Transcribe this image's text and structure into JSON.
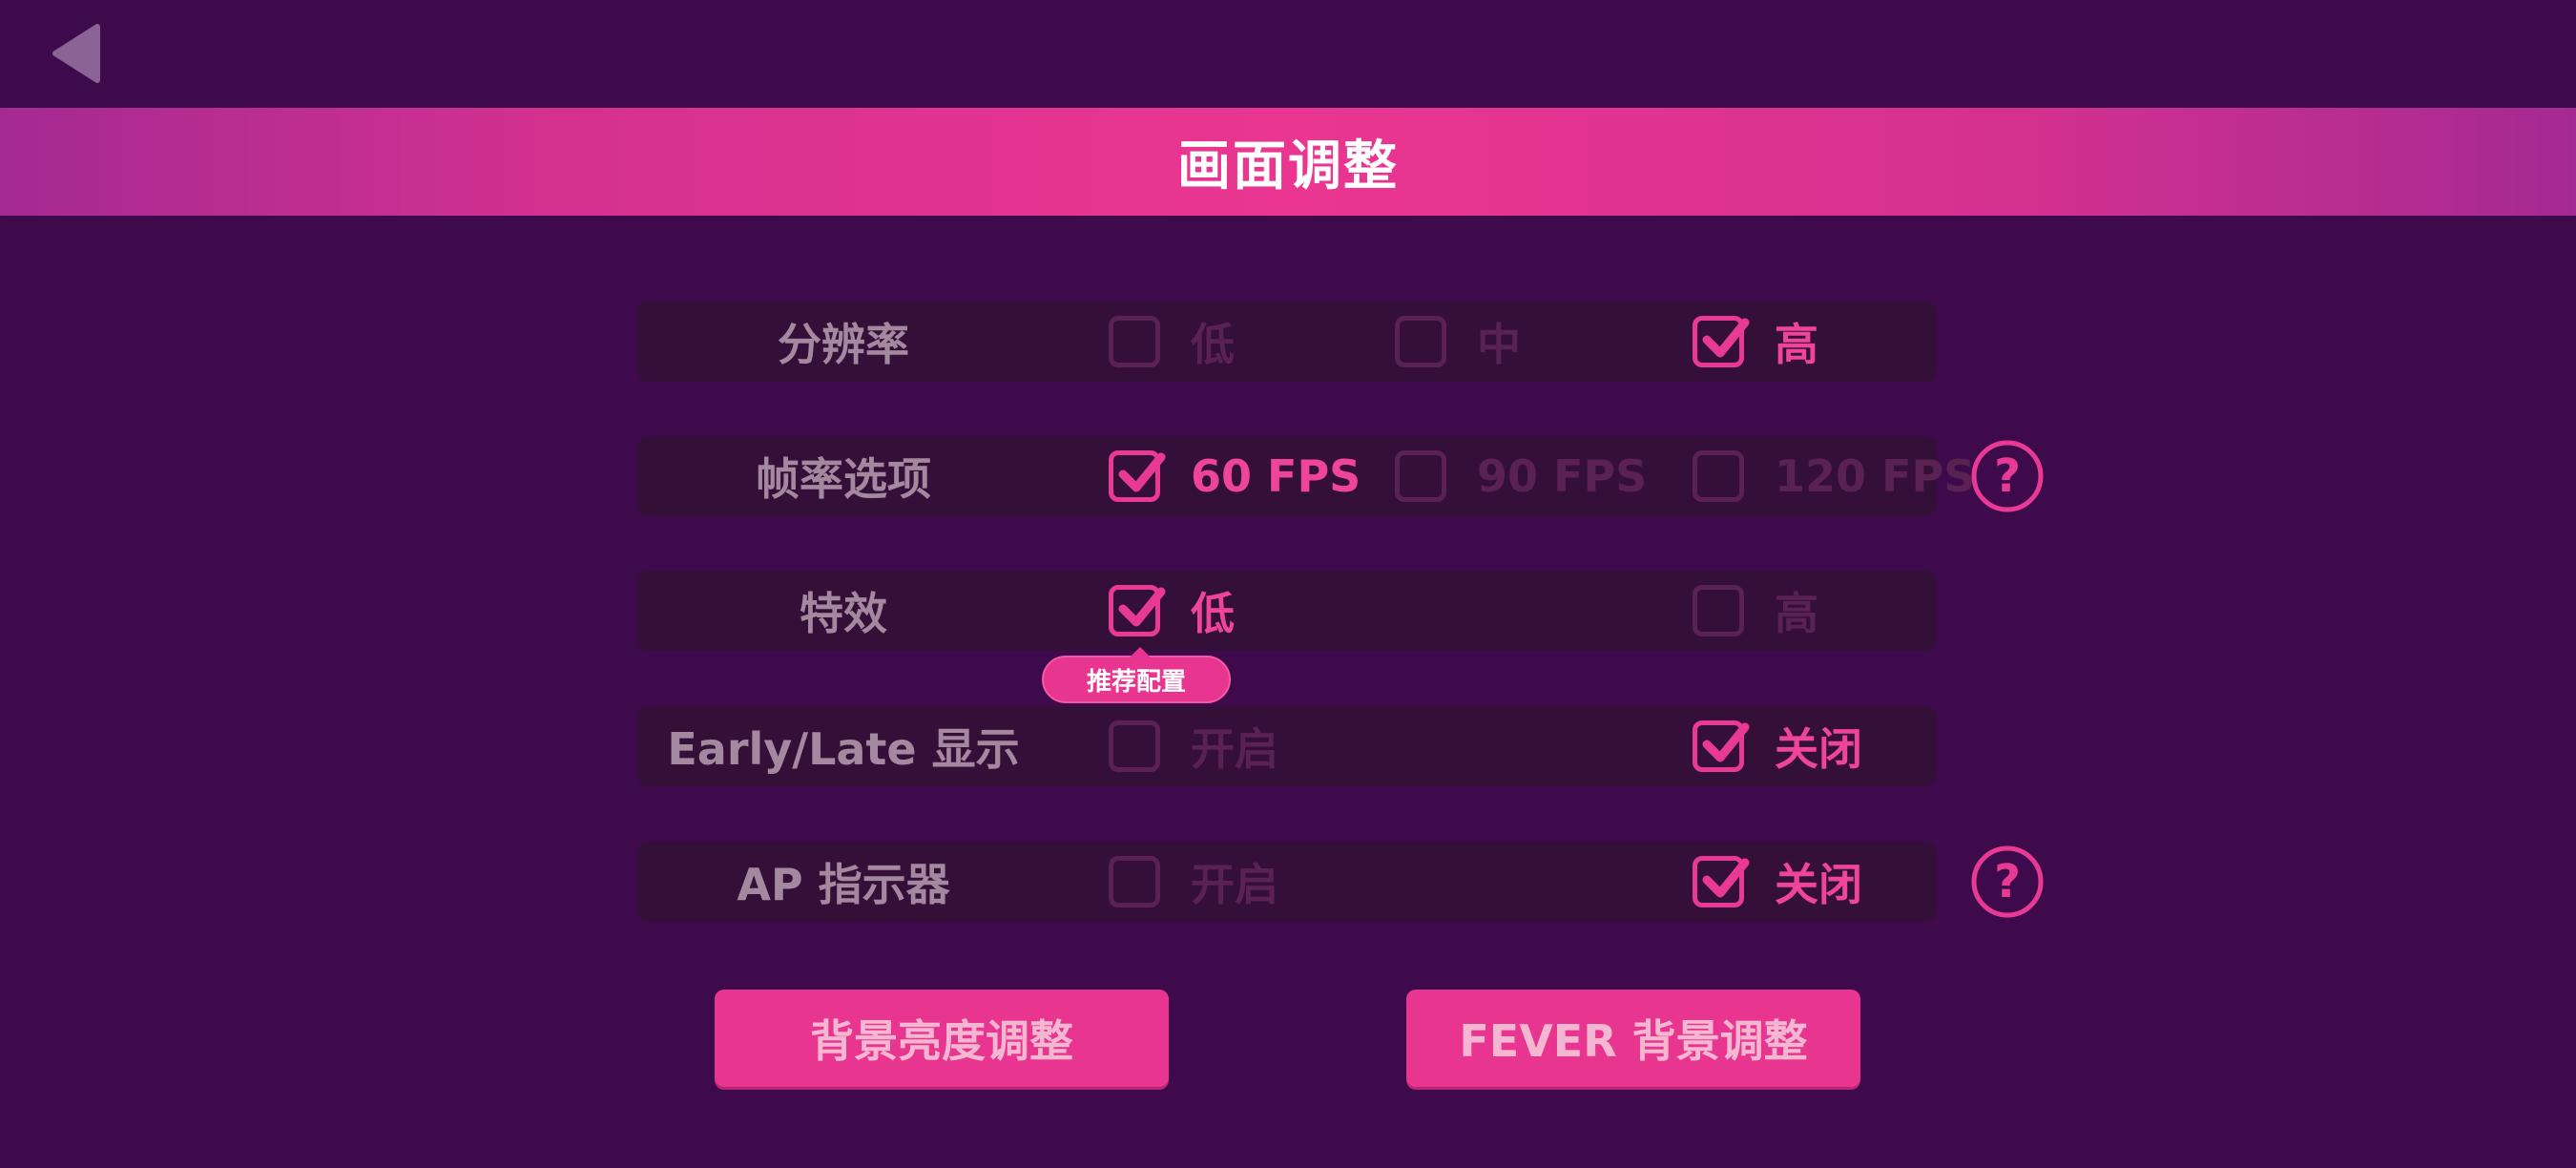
{
  "header": {
    "back_icon": "back-triangle-icon",
    "title": "画面调整"
  },
  "settings": {
    "resolution": {
      "label": "分辨率",
      "options": [
        {
          "label": "低",
          "checked": false
        },
        {
          "label": "中",
          "checked": false
        },
        {
          "label": "高",
          "checked": true
        }
      ]
    },
    "framerate": {
      "label": "帧率选项",
      "options": [
        {
          "label": "60 FPS",
          "checked": true
        },
        {
          "label": "90 FPS",
          "checked": false
        },
        {
          "label": "120 FPS",
          "checked": false
        }
      ],
      "help_icon": "question-mark-icon"
    },
    "effects": {
      "label": "特效",
      "options": [
        {
          "label": "低",
          "checked": true
        },
        {
          "label": "高",
          "checked": false
        }
      ],
      "recommend_tooltip": "推荐配置"
    },
    "early_late": {
      "label": "Early/Late 显示",
      "options": [
        {
          "label": "开启",
          "checked": false
        },
        {
          "label": "关闭",
          "checked": true
        }
      ]
    },
    "ap_indicator": {
      "label": "AP 指示器",
      "options": [
        {
          "label": "开启",
          "checked": false
        },
        {
          "label": "关闭",
          "checked": true
        }
      ],
      "help_icon": "question-mark-icon"
    }
  },
  "buttons": {
    "bg_brightness": "背景亮度调整",
    "fever_bg": "FEVER 背景调整"
  },
  "colors": {
    "background": "#3e0a4c",
    "row_background": "#341038",
    "accent_pink": "#e8358f",
    "inactive": "#5a2252",
    "label_gray": "#a4889f"
  }
}
